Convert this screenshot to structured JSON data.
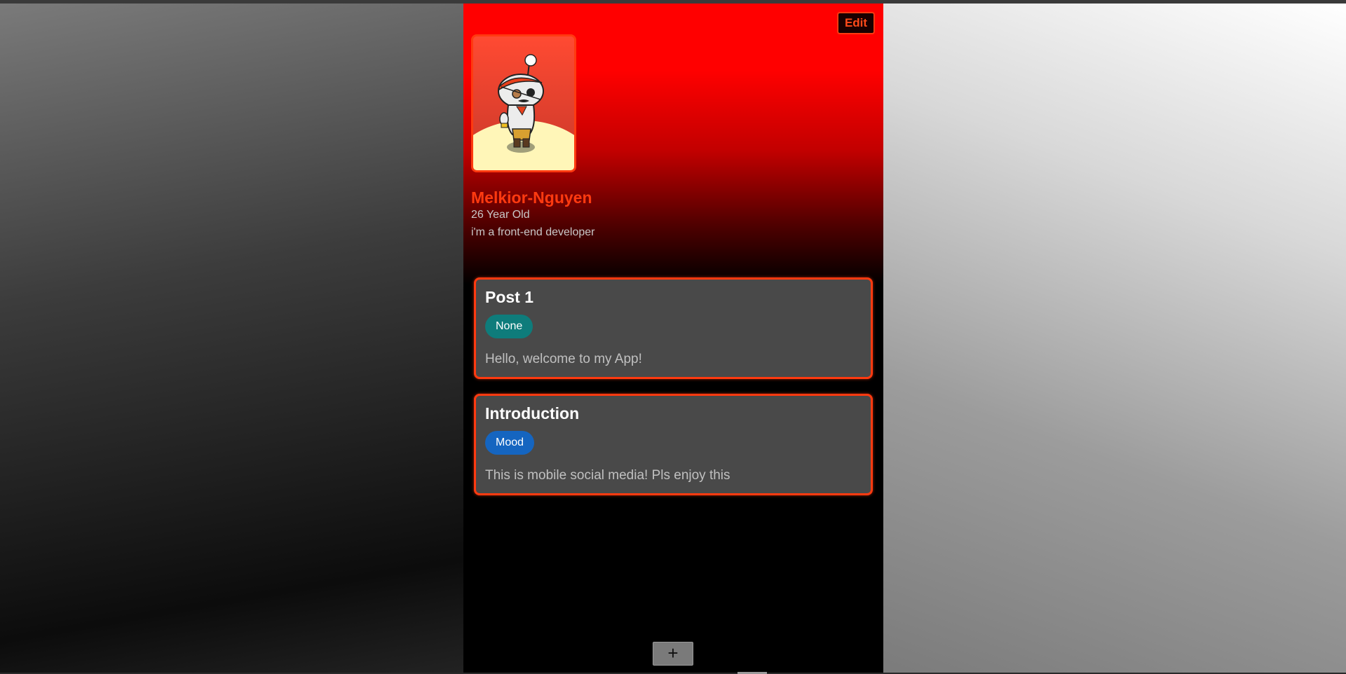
{
  "profile": {
    "edit_label": "Edit",
    "name": "Melkior-Nguyen",
    "age": "26 Year Old",
    "bio": "i'm a front-end developer",
    "avatar_icon": "reddit-pirate-avatar-icon"
  },
  "posts": [
    {
      "title": "Post 1",
      "tag": "None",
      "tag_color": "#0e7c7b",
      "body": "Hello, welcome to my App!"
    },
    {
      "title": "Introduction",
      "tag": "Mood",
      "tag_color": "#1565c0",
      "body": "This is mobile social media! Pls enjoy this"
    }
  ],
  "footer": {
    "add_label": "+"
  },
  "colors": {
    "accent": "#ff3a10",
    "card_bg": "#494949"
  }
}
